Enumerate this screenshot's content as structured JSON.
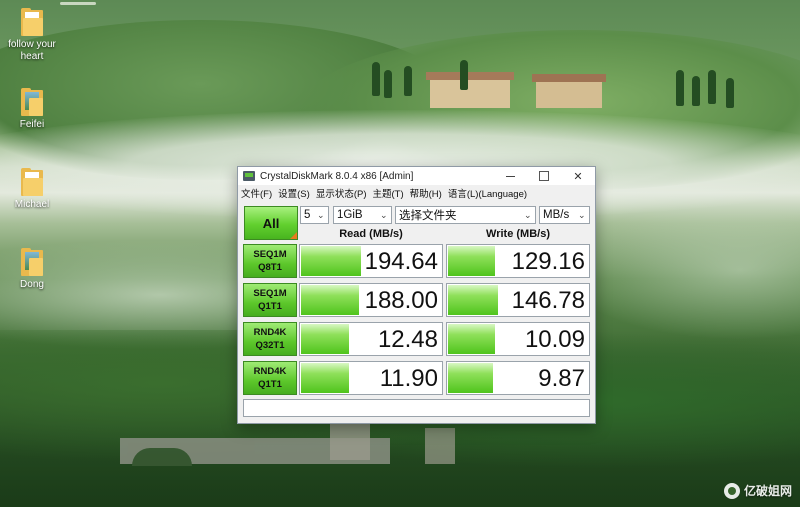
{
  "desktop": {
    "icons": [
      {
        "label": "follow your\nheart",
        "kind": "folder"
      },
      {
        "label": "Feifei",
        "kind": "photo"
      },
      {
        "label": "Michael",
        "kind": "folder"
      },
      {
        "label": "Dong",
        "kind": "photo"
      }
    ],
    "watermark": "亿破姐网"
  },
  "window": {
    "title": "CrystalDiskMark 8.0.4 x86 [Admin]",
    "menu": [
      "文件(F)",
      "设置(S)",
      "显示状态(P)",
      "主题(T)",
      "帮助(H)",
      "语言(L)(Language)"
    ],
    "controls": {
      "all_label": "All",
      "count": "5",
      "size": "1GiB",
      "drive": "选择文件夹",
      "unit": "MB/s"
    },
    "headers": {
      "read": "Read (MB/s)",
      "write": "Write (MB/s)"
    },
    "tests": [
      {
        "line1": "SEQ1M",
        "line2": "Q8T1",
        "read": "194.64",
        "write": "129.16",
        "read_fill": 0.42,
        "write_fill": 0.33
      },
      {
        "line1": "SEQ1M",
        "line2": "Q1T1",
        "read": "188.00",
        "write": "146.78",
        "read_fill": 0.41,
        "write_fill": 0.35
      },
      {
        "line1": "RND4K",
        "line2": "Q32T1",
        "read": "12.48",
        "write": "10.09",
        "read_fill": 0.34,
        "write_fill": 0.33
      },
      {
        "line1": "RND4K",
        "line2": "Q1T1",
        "read": "11.90",
        "write": "9.87",
        "read_fill": 0.34,
        "write_fill": 0.32
      }
    ],
    "comment": ""
  }
}
